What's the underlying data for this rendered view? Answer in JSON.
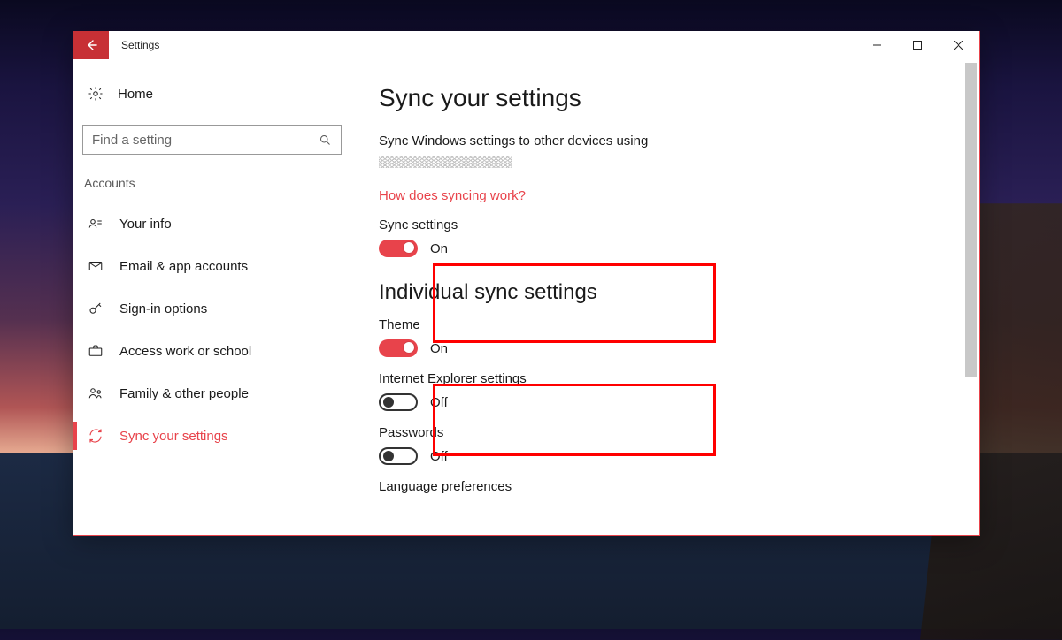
{
  "window": {
    "title": "Settings"
  },
  "sidebar": {
    "home_label": "Home",
    "search_placeholder": "Find a setting",
    "section_label": "Accounts",
    "items": [
      {
        "label": "Your info"
      },
      {
        "label": "Email & app accounts"
      },
      {
        "label": "Sign-in options"
      },
      {
        "label": "Access work or school"
      },
      {
        "label": "Family & other people"
      },
      {
        "label": "Sync your settings"
      }
    ],
    "active_index": 5
  },
  "main": {
    "heading": "Sync your settings",
    "description": "Sync Windows settings to other devices using",
    "help_link": "How does syncing work?",
    "sync_settings": {
      "label": "Sync settings",
      "state_label": "On",
      "on": true
    },
    "individual_heading": "Individual sync settings",
    "individual": [
      {
        "label": "Theme",
        "state_label": "On",
        "on": true
      },
      {
        "label": "Internet Explorer settings",
        "state_label": "Off",
        "on": false
      },
      {
        "label": "Passwords",
        "state_label": "Off",
        "on": false
      }
    ],
    "cutoff_label": "Language preferences"
  }
}
